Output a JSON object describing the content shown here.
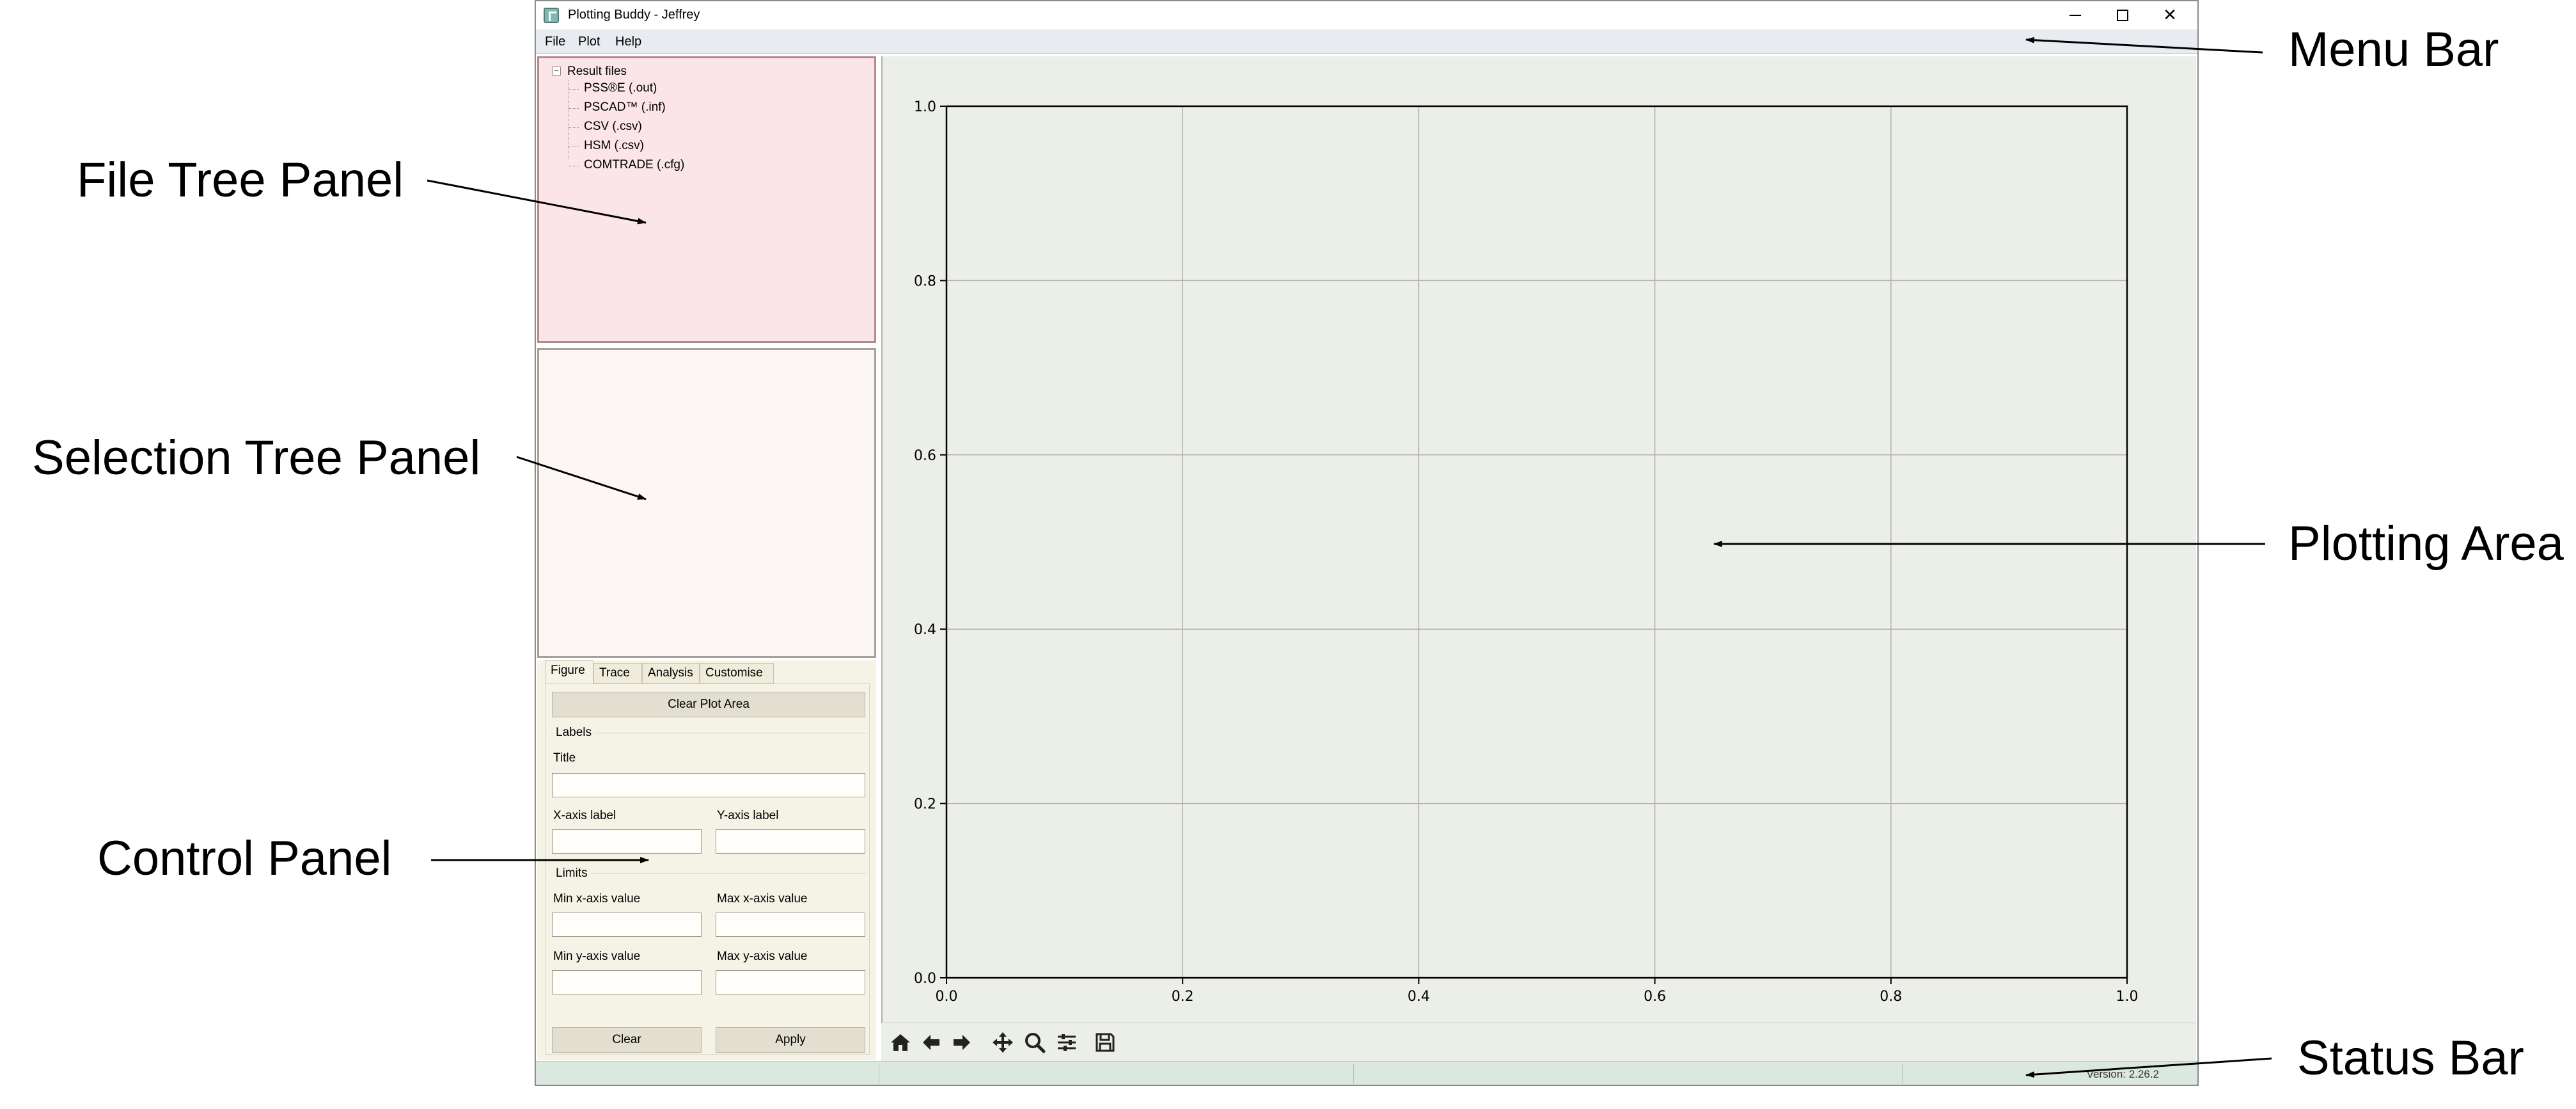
{
  "window": {
    "title": "Plotting Buddy - Jeffrey",
    "controls": [
      "minimize",
      "maximize",
      "close"
    ]
  },
  "menu": {
    "file": "File",
    "plot": "Plot",
    "help": "Help"
  },
  "file_tree": {
    "root": "Result files",
    "root_expander": "−",
    "children": [
      "PSS®E (.out)",
      "PSCAD™ (.inf)",
      "CSV (.csv)",
      "HSM (.csv)",
      "COMTRADE (.cfg)"
    ]
  },
  "control_panel": {
    "tabs": [
      "Figure",
      "Trace",
      "Analysis",
      "Customise"
    ],
    "active_tab": "Figure",
    "clear_plot_area": "Clear Plot Area",
    "labels_group": "Labels",
    "title_label": "Title",
    "title_value": "",
    "x_axis_label": "X-axis label",
    "x_axis_value": "",
    "y_axis_label": "Y-axis label",
    "y_axis_value": "",
    "limits_group": "Limits",
    "min_x_label": "Min x-axis value",
    "min_x_value": "",
    "max_x_label": "Max x-axis value",
    "max_x_value": "",
    "min_y_label": "Min y-axis value",
    "min_y_value": "",
    "max_y_label": "Max y-axis value",
    "max_y_value": "",
    "clear": "Clear",
    "apply": "Apply"
  },
  "plot_toolbar": {
    "icons": [
      "home-icon",
      "back-arrow-icon",
      "forward-arrow-icon",
      "pan-icon",
      "zoom-icon",
      "configure-subplots-icon",
      "save-icon"
    ]
  },
  "status_bar": {
    "version": "Version: 2.26.2"
  },
  "annotations": {
    "menu_bar": "Menu Bar",
    "file_tree_panel": "File Tree Panel",
    "selection_tree_panel": "Selection Tree Panel",
    "plotting_area": "Plotting Area",
    "control_panel": "Control Panel",
    "status_bar": "Status Bar"
  },
  "chart_data": {
    "type": "line",
    "series": [],
    "xlim": [
      0.0,
      1.0
    ],
    "ylim": [
      0.0,
      1.0
    ],
    "xticks": [
      "0.0",
      "0.2",
      "0.4",
      "0.6",
      "0.8",
      "1.0"
    ],
    "yticks": [
      "0.0",
      "0.2",
      "0.4",
      "0.6",
      "0.8",
      "1.0"
    ],
    "grid": true,
    "colors": {
      "background": "#eceee8",
      "grid": "#b0b0b0",
      "axis": "#000000"
    }
  }
}
